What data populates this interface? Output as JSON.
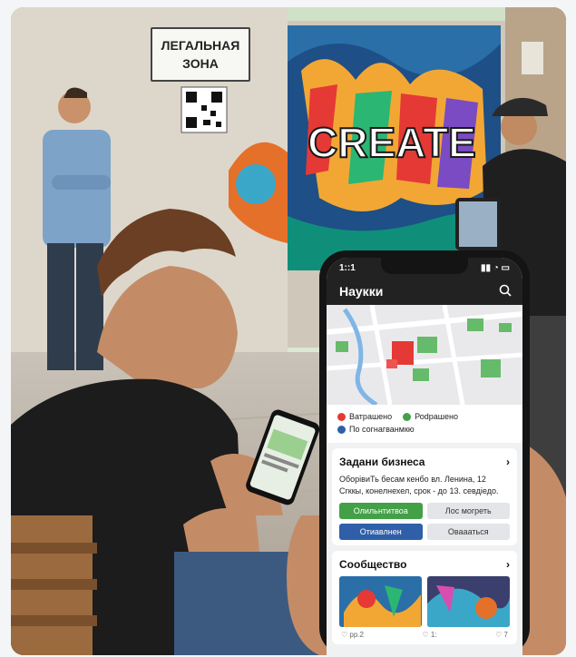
{
  "sign": {
    "line1": "ЛЕГАЛЬНАЯ",
    "line2": "ЗОНА"
  },
  "mural": {
    "text": "CREATE"
  },
  "phone": {
    "status_time": "1::1",
    "app_title": "Наукки",
    "legend": [
      {
        "label": "Ватрашено",
        "color": "#e53935"
      },
      {
        "label": "Роdрашено",
        "color": "#43a047"
      },
      {
        "label": "По согнагванмкю",
        "color": "#2f5fa8"
      }
    ],
    "task": {
      "title": "Задани бизнеса",
      "body": "ОборівиТь бесам кенбо вл. Ленина, 12 Сгккы, конелнехел, срок - до 13. севдіедо.",
      "buttons": [
        "Олильнтитвоа",
        "Лос могреть",
        "Отиавлнен",
        "Оваааться"
      ]
    },
    "community": {
      "title": "Сообщество",
      "likes": [
        "♡ рр.2",
        "♡ 1:",
        "♡ 7"
      ]
    }
  }
}
